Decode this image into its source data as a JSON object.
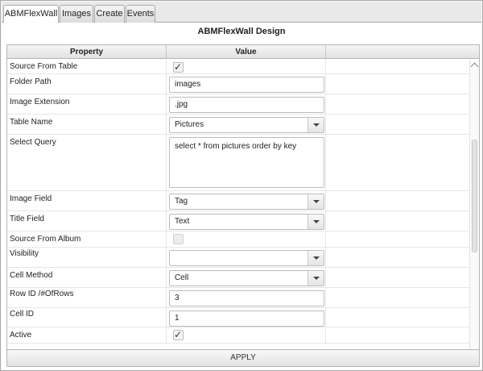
{
  "tabs": [
    "ABMFlexWall",
    "Images",
    "Create",
    "Events"
  ],
  "design_title": "ABMFlexWall Design",
  "grid": {
    "headers": {
      "property": "Property",
      "value": "Value"
    },
    "rows": [
      {
        "label": "Source From Table",
        "type": "checkbox",
        "checked": true
      },
      {
        "label": "Folder Path",
        "type": "text",
        "value": "images"
      },
      {
        "label": "Image Extension",
        "type": "text",
        "value": ".jpg"
      },
      {
        "label": "Table Name",
        "type": "combo",
        "value": "Pictures"
      },
      {
        "label": "Select Query",
        "type": "textarea",
        "value": "select * from pictures order by key"
      },
      {
        "label": "Image Field",
        "type": "combo",
        "value": "Tag"
      },
      {
        "label": "Title Field",
        "type": "combo",
        "value": "Text"
      },
      {
        "label": "Source From Album",
        "type": "checkbox",
        "checked": false
      },
      {
        "label": "Visibility",
        "type": "combo",
        "value": ""
      },
      {
        "label": "Cell Method",
        "type": "combo",
        "value": "Cell"
      },
      {
        "label": "Row ID /#OfRows",
        "type": "text",
        "value": "3"
      },
      {
        "label": "Cell ID",
        "type": "text",
        "value": "1"
      },
      {
        "label": "Active",
        "type": "checkbox",
        "checked": true
      }
    ]
  },
  "apply_label": "APPLY",
  "icons": {
    "check": "check-icon",
    "dropdown": "chevron-down-icon"
  },
  "colors": {
    "border": "#a9a9a9",
    "tab_active": "#ffffff"
  }
}
